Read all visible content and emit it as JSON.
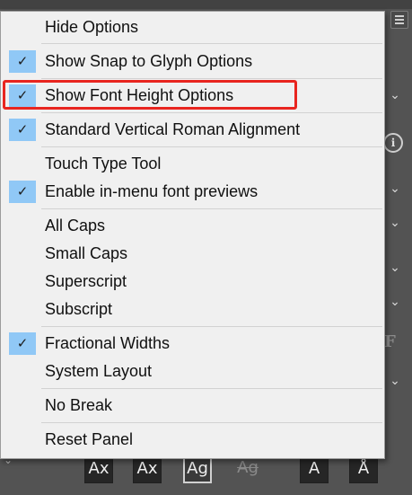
{
  "menu": {
    "items": [
      {
        "label": "Hide Options",
        "checked": false
      },
      {
        "label": "Show Snap to Glyph Options",
        "checked": true
      },
      {
        "label": "Show Font Height Options",
        "checked": true
      },
      {
        "label": "Standard Vertical Roman Alignment",
        "checked": true
      },
      {
        "label": "Touch Type Tool",
        "checked": false
      },
      {
        "label": "Enable in-menu font previews",
        "checked": true
      },
      {
        "label": "All Caps",
        "checked": false
      },
      {
        "label": "Small Caps",
        "checked": false
      },
      {
        "label": "Superscript",
        "checked": false
      },
      {
        "label": "Subscript",
        "checked": false
      },
      {
        "label": "Fractional Widths",
        "checked": true
      },
      {
        "label": "System Layout",
        "checked": false
      },
      {
        "label": "No Break",
        "checked": false
      },
      {
        "label": "Reset Panel",
        "checked": false
      }
    ],
    "check_glyph": "✓",
    "highlighted_item": "Show Font Height Options",
    "highlight_color": "#e8251f",
    "check_bg_color": "#90c8f6"
  },
  "toolbar": {
    "glyphs": [
      {
        "icon": "all-caps-glyph-icon",
        "glyph": "Ax"
      },
      {
        "icon": "small-caps-glyph-icon",
        "glyph": "Ax"
      },
      {
        "icon": "superscript-glyph-icon",
        "glyph": "Ag"
      },
      {
        "icon": "strikethrough-glyph-icon",
        "glyph": "Ag"
      },
      {
        "icon": "italic-a-glyph-icon",
        "glyph": "A"
      },
      {
        "icon": "accent-a-glyph-icon",
        "glyph": "Å"
      }
    ]
  },
  "panel": {
    "info_glyph": "i",
    "font_glyph": "F",
    "chevron_glyph": "⌄"
  }
}
